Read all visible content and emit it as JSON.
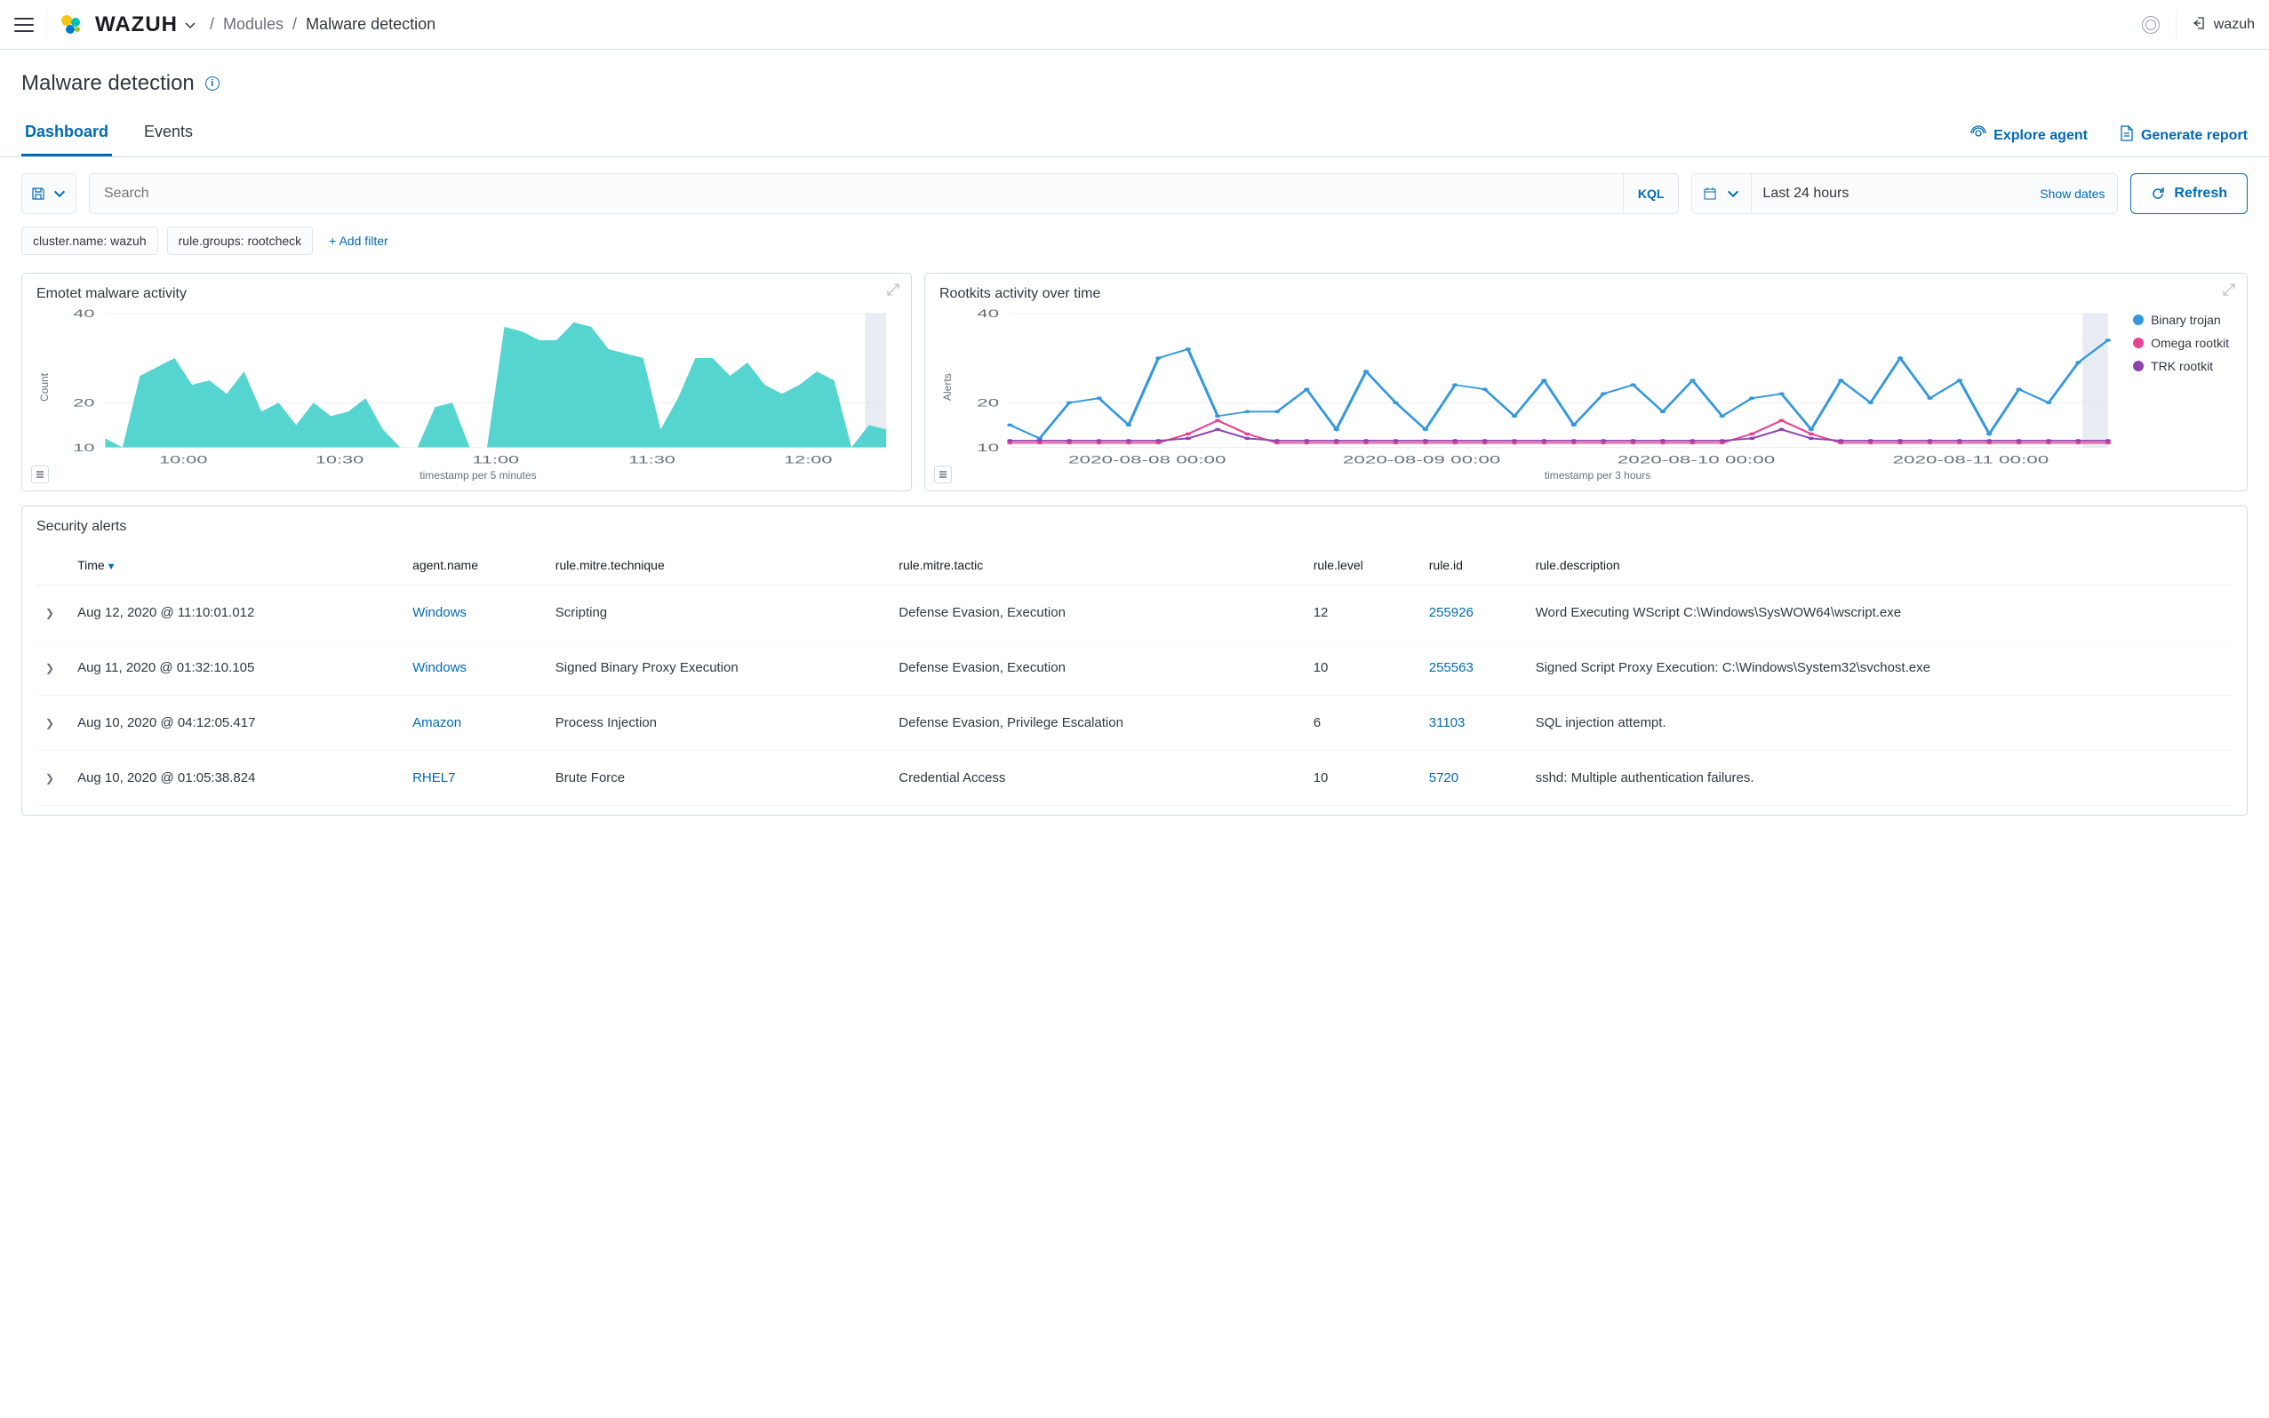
{
  "header": {
    "brand": "WAZUH",
    "breadcrumb_parent": "Modules",
    "breadcrumb_current": "Malware detection",
    "user_label": "wazuh"
  },
  "page": {
    "title": "Malware detection",
    "tabs": {
      "dashboard": "Dashboard",
      "events": "Events"
    },
    "actions": {
      "explore_agent": "Explore agent",
      "generate_report": "Generate report"
    }
  },
  "toolbar": {
    "search_placeholder": "Search",
    "kql_label": "KQL",
    "date_range": "Last 24 hours",
    "show_dates": "Show dates",
    "refresh": "Refresh",
    "filters": [
      "cluster.name: wazuh",
      "rule.groups: rootcheck"
    ],
    "add_filter": "+ Add filter"
  },
  "charts": {
    "emotet": {
      "title": "Emotet malware activity",
      "ylabel": "Count",
      "xlabel": "timestamp per 5 minutes"
    },
    "rootkits": {
      "title": "Rootkits activity over time",
      "ylabel": "Alerts",
      "xlabel": "timestamp per 3 hours",
      "legend": {
        "binary": "Binary trojan",
        "omega": "Omega rootkit",
        "trk": "TRK rootkit"
      }
    }
  },
  "chart_data": [
    {
      "id": "emotet",
      "type": "area",
      "title": "Emotet malware activity",
      "xlabel": "timestamp per 5 minutes",
      "ylabel": "Count",
      "ylim": [
        10,
        40
      ],
      "x_ticks": [
        "10:00",
        "10:30",
        "11:00",
        "11:30",
        "12:00"
      ],
      "y_ticks": [
        10,
        20,
        40
      ],
      "series": [
        {
          "name": "Emotet",
          "color": "#4dd2ce",
          "values": [
            12,
            10,
            26,
            28,
            30,
            24,
            25,
            22,
            27,
            18,
            20,
            15,
            20,
            17,
            18,
            21,
            14,
            10,
            10,
            19,
            20,
            10,
            10,
            37,
            36,
            34,
            34,
            38,
            37,
            32,
            31,
            30,
            14,
            21,
            30,
            30,
            26,
            29,
            24,
            22,
            24,
            27,
            25,
            10,
            15,
            14
          ]
        }
      ]
    },
    {
      "id": "rootkits",
      "type": "line",
      "title": "Rootkits activity over time",
      "xlabel": "timestamp per 3 hours",
      "ylabel": "Alerts",
      "ylim": [
        10,
        40
      ],
      "x_ticks": [
        "2020-08-08 00:00",
        "2020-08-09 00:00",
        "2020-08-10 00:00",
        "2020-08-11 00:00"
      ],
      "y_ticks": [
        10,
        20,
        40
      ],
      "legend_position": "right",
      "series": [
        {
          "name": "Binary trojan",
          "color": "#3498db",
          "values": [
            15,
            12,
            20,
            21,
            15,
            30,
            32,
            17,
            18,
            18,
            23,
            14,
            27,
            20,
            14,
            24,
            23,
            17,
            25,
            15,
            22,
            24,
            18,
            25,
            17,
            21,
            22,
            14,
            25,
            20,
            30,
            21,
            25,
            13,
            23,
            20,
            29,
            34
          ]
        },
        {
          "name": "Omega rootkit",
          "color": "#e84393",
          "values": [
            11,
            11,
            11,
            11,
            11,
            11,
            13,
            16,
            13,
            11,
            11,
            11,
            11,
            11,
            11,
            11,
            11,
            11,
            11,
            11,
            11,
            11,
            11,
            11,
            11,
            13,
            16,
            13,
            11,
            11,
            11,
            11,
            11,
            11,
            11,
            11,
            11,
            11
          ]
        },
        {
          "name": "TRK rootkit",
          "color": "#8e44ad",
          "values": [
            11.5,
            11.5,
            11.5,
            11.5,
            11.5,
            11.5,
            12,
            14,
            12,
            11.5,
            11.5,
            11.5,
            11.5,
            11.5,
            11.5,
            11.5,
            11.5,
            11.5,
            11.5,
            11.5,
            11.5,
            11.5,
            11.5,
            11.5,
            11.5,
            12,
            14,
            12,
            11.5,
            11.5,
            11.5,
            11.5,
            11.5,
            11.5,
            11.5,
            11.5,
            11.5,
            11.5
          ]
        }
      ]
    }
  ],
  "alerts": {
    "title": "Security alerts",
    "columns": {
      "time": "Time",
      "agent": "agent.name",
      "technique": "rule.mitre.technique",
      "tactic": "rule.mitre.tactic",
      "level": "rule.level",
      "rule_id": "rule.id",
      "description": "rule.description"
    },
    "rows": [
      {
        "time": "Aug 12, 2020 @ 11:10:01.012",
        "agent": "Windows",
        "technique": "Scripting",
        "tactic": "Defense Evasion, Execution",
        "level": "12",
        "rule_id": "255926",
        "description": "Word Executing WScript C:\\Windows\\SysWOW64\\wscript.exe"
      },
      {
        "time": "Aug 11, 2020 @ 01:32:10.105",
        "agent": "Windows",
        "technique": "Signed Binary Proxy Execution",
        "tactic": "Defense Evasion, Execution",
        "level": "10",
        "rule_id": "255563",
        "description": "Signed Script Proxy Execution: C:\\Windows\\System32\\svchost.exe"
      },
      {
        "time": "Aug 10, 2020 @ 04:12:05.417",
        "agent": "Amazon",
        "technique": "Process Injection",
        "tactic": "Defense Evasion, Privilege Escalation",
        "level": "6",
        "rule_id": "31103",
        "description": "SQL injection attempt."
      },
      {
        "time": "Aug 10, 2020 @ 01:05:38.824",
        "agent": "RHEL7",
        "technique": "Brute Force",
        "tactic": "Credential Access",
        "level": "10",
        "rule_id": "5720",
        "description": "sshd: Multiple authentication failures."
      }
    ]
  }
}
